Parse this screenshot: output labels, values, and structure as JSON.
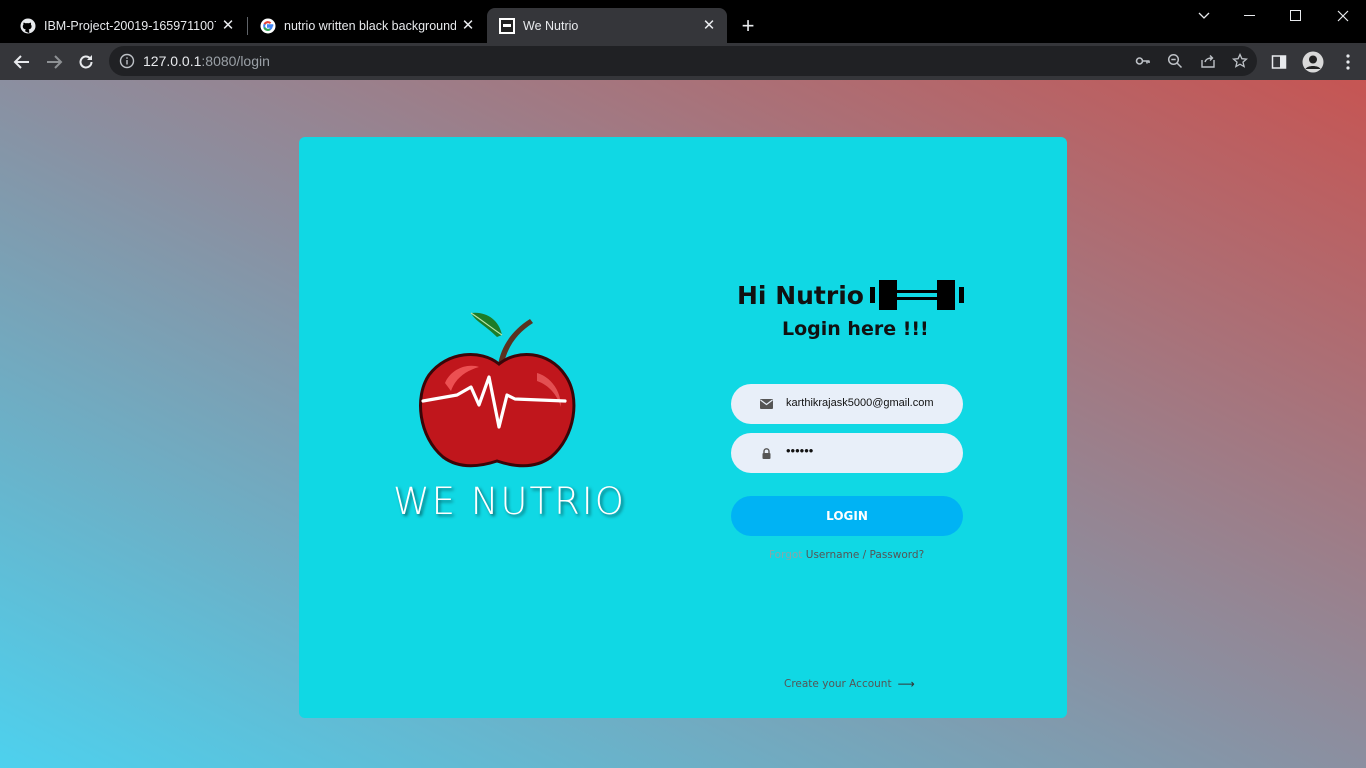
{
  "browser": {
    "tabs": [
      {
        "title": "IBM-Project-20019-1659711007/",
        "favicon": "github-icon"
      },
      {
        "title": "nutrio written black background",
        "favicon": "google-icon"
      },
      {
        "title": "We Nutrio",
        "favicon": "we-nutrio-icon",
        "active": true
      }
    ],
    "address": {
      "host": "127.0.0.1",
      "path": ":8080/login"
    }
  },
  "page": {
    "brand_name": "WE NUTRIO",
    "greeting": "Hi Nutrio",
    "subtitle": "Login here !!!",
    "email_value": "karthikrajask5000@gmail.com",
    "password_mask": "••••••",
    "login_label": "LOGIN",
    "forgot_prefix": "Forgot",
    "forgot_link": "Username / Password?",
    "create_account": "Create your Account",
    "colors": {
      "card": "#10d8e4",
      "button": "#00b3f4",
      "field": "#e8eff9"
    }
  }
}
